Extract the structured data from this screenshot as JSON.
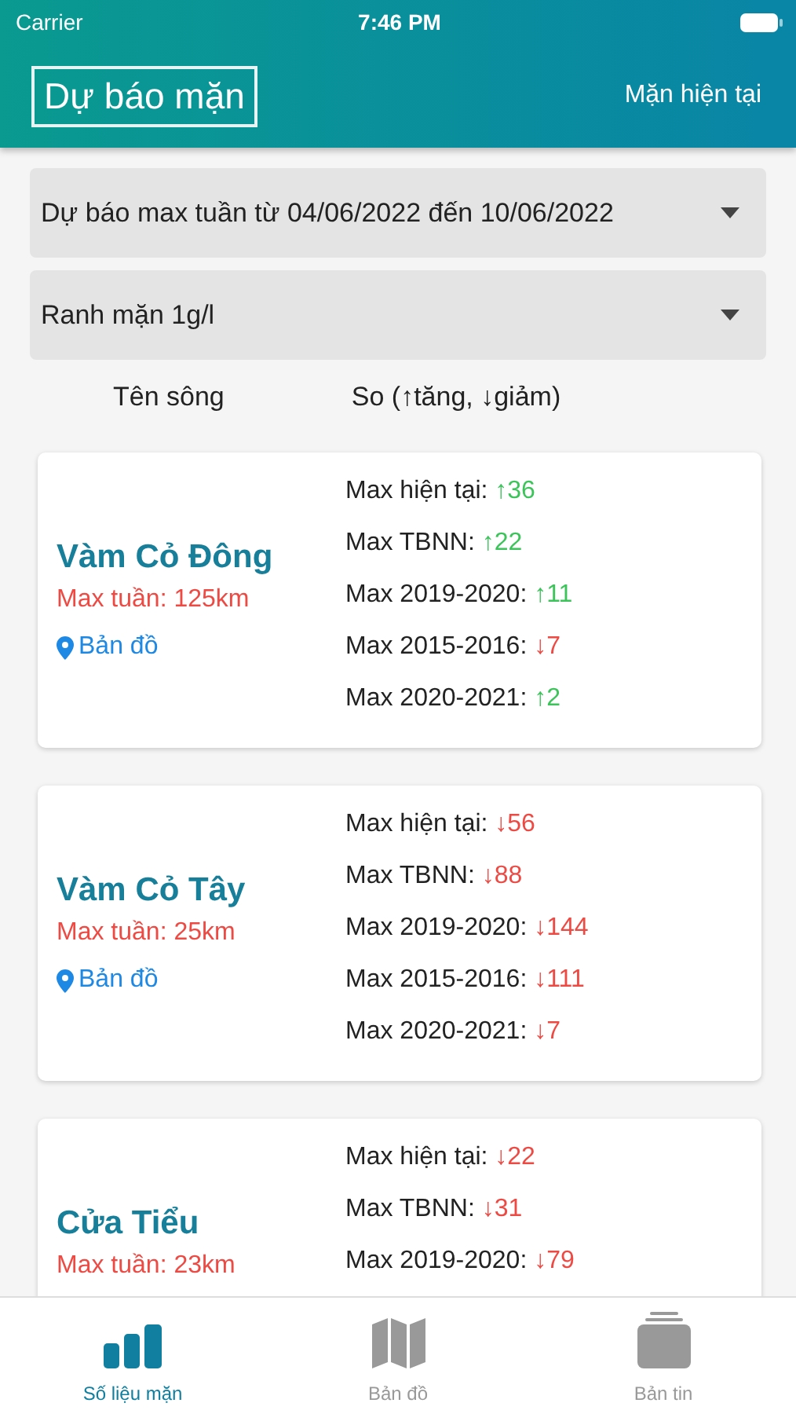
{
  "status_bar": {
    "carrier": "Carrier",
    "time": "7:46 PM"
  },
  "header": {
    "title": "Dự báo mặn",
    "action": "Mặn hiện tại"
  },
  "dropdowns": [
    {
      "value": "Dự báo max tuần từ 04/06/2022 đến 10/06/2022"
    },
    {
      "value": "Ranh mặn 1g/l"
    }
  ],
  "columns": [
    "Tên sông",
    "So (↑tăng, ↓giảm)"
  ],
  "rivers": [
    {
      "name": "Vàm Cỏ Đông",
      "max_week": "Max tuần: 125km",
      "map_link": "Bản đồ",
      "stats": [
        {
          "label": "Max hiện tại:",
          "value": "↑36",
          "color": "#3cc45a"
        },
        {
          "label": "Max TBNN:",
          "value": "↑22",
          "color": "#3cc45a"
        },
        {
          "label": "Max 2019-2020:",
          "value": "↑11",
          "color": "#3cc45a"
        },
        {
          "label": "Max 2015-2016:",
          "value": "↓7",
          "color": "#ee4a44"
        },
        {
          "label": "Max 2020-2021:",
          "value": "↑2",
          "color": "#3cc45a"
        }
      ]
    },
    {
      "name": "Vàm Cỏ Tây",
      "max_week": "Max tuần: 25km",
      "map_link": "Bản đồ",
      "stats": [
        {
          "label": "Max hiện tại:",
          "value": "↓56",
          "color": "#ee4a44"
        },
        {
          "label": "Max TBNN:",
          "value": "↓88",
          "color": "#ee4a44"
        },
        {
          "label": "Max 2019-2020:",
          "value": "↓144",
          "color": "#ee4a44"
        },
        {
          "label": "Max 2015-2016:",
          "value": "↓111",
          "color": "#ee4a44"
        },
        {
          "label": "Max 2020-2021:",
          "value": "↓7",
          "color": "#ee4a44"
        }
      ]
    },
    {
      "name": "Cửa Tiểu",
      "max_week": "Max tuần: 23km",
      "stats": [
        {
          "label": "Max hiện tại:",
          "value": "↓22",
          "color": "#ee4a44"
        },
        {
          "label": "Max TBNN:",
          "value": "↓31",
          "color": "#ee4a44"
        },
        {
          "label": "Max 2019-2020:",
          "value": "↓79",
          "color": "#ee4a44"
        }
      ]
    }
  ],
  "tabs": [
    {
      "label": "Số liệu mặn",
      "kind": "bars",
      "selected": true
    },
    {
      "label": "Bản đồ",
      "kind": "map",
      "selected": false
    },
    {
      "label": "Bản tin",
      "kind": "stack",
      "selected": false
    }
  ]
}
